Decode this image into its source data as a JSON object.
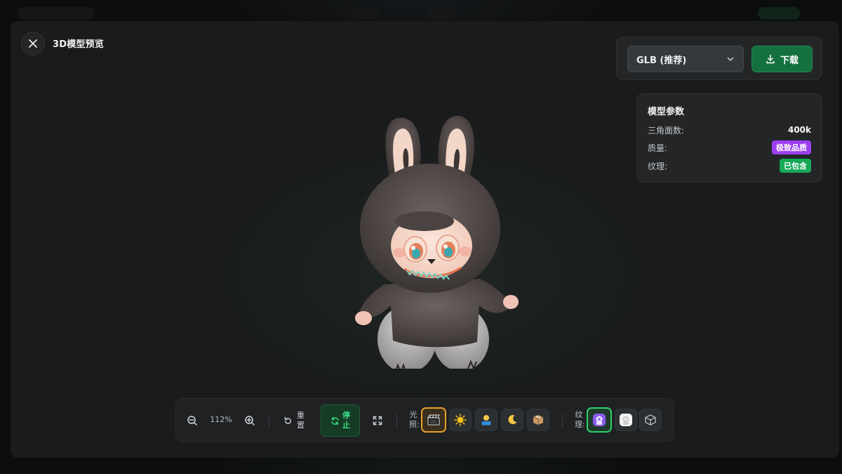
{
  "window": {
    "title": "3D模型预览"
  },
  "download": {
    "format_selected": "GLB (推荐)",
    "button_label": "下载"
  },
  "params": {
    "title": "模型参数",
    "rows": [
      {
        "label": "三角面数:",
        "value": "400k"
      },
      {
        "label": "质量:",
        "value": "极致品质",
        "badge_color": "#9b3ff0"
      },
      {
        "label": "纹理:",
        "value": "已包含",
        "badge_color": "#16a857"
      }
    ]
  },
  "toolbar": {
    "zoom_value": "112%",
    "reset_label": "重置",
    "spin_label": "停止",
    "lighting_label": "光照:",
    "lighting_options": [
      "studio-lighting-icon",
      "sun-lighting-icon",
      "portrait-lighting-icon",
      "night-lighting-icon",
      "box-lighting-icon"
    ],
    "lighting_selected": "studio-lighting-icon",
    "texture_label": "纹理:",
    "texture_options": [
      "texture-color-icon",
      "texture-white-icon",
      "texture-wireframe-icon"
    ],
    "texture_selected": "texture-color-icon"
  },
  "colors": {
    "accent_green": "#15703f",
    "active_light": "#e7a22a",
    "active_texture": "#2fd26a"
  }
}
